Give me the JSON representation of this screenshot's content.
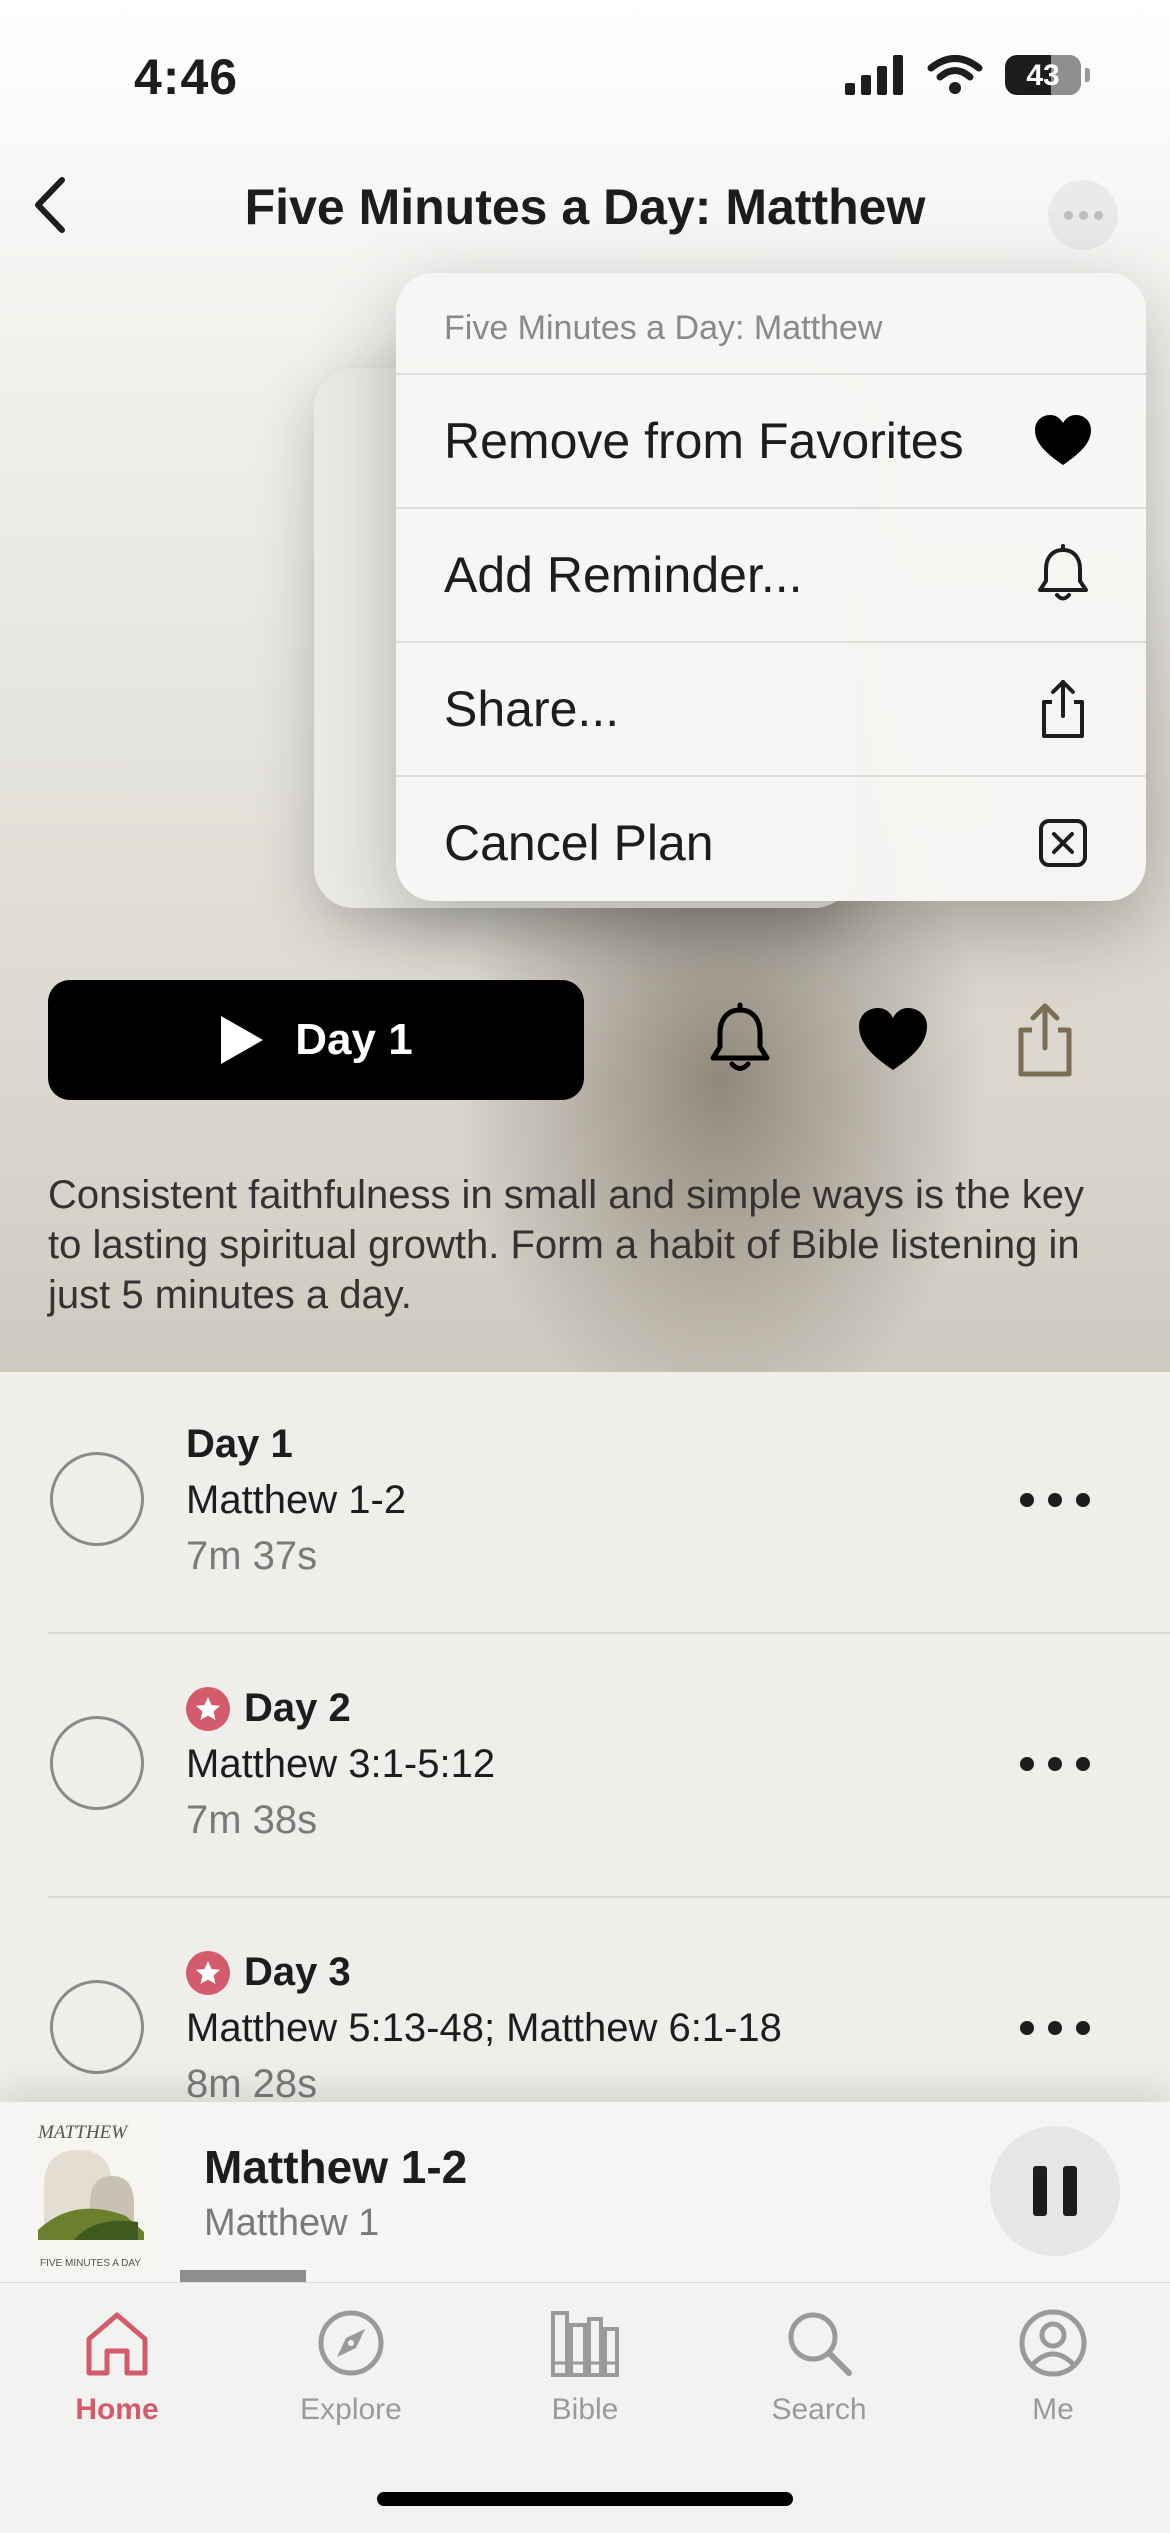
{
  "status_bar": {
    "time": "4:46",
    "battery": "43"
  },
  "nav": {
    "title": "Five Minutes a Day: Matthew"
  },
  "context_menu": {
    "header": "Five Minutes a Day: Matthew",
    "items": [
      {
        "label": "Remove from Favorites",
        "icon": "heart-filled-icon"
      },
      {
        "label": "Add Reminder...",
        "icon": "bell-icon"
      },
      {
        "label": "Share...",
        "icon": "share-icon"
      },
      {
        "label": "Cancel Plan",
        "icon": "x-square-icon"
      }
    ]
  },
  "actions": {
    "play_label": "Day 1"
  },
  "description": "Consistent faithfulness in small and simple ways is the key to lasting spiritual growth. Form a habit of Bible listening in just 5 minutes a day.",
  "plan_days": [
    {
      "day": "Day 1",
      "reference": "Matthew 1-2",
      "duration": "7m 37s",
      "starred": false
    },
    {
      "day": "Day 2",
      "reference": "Matthew 3:1-5:12",
      "duration": "7m 38s",
      "starred": true
    },
    {
      "day": "Day 3",
      "reference": "Matthew 5:13-48; Matthew 6:1-18",
      "duration": "8m 28s",
      "starred": true
    }
  ],
  "mini_player": {
    "title": "Matthew 1-2",
    "subtitle": "Matthew 1",
    "art_title": "MATTHEW",
    "art_caption": "FIVE MINUTES A DAY",
    "progress": 0.1
  },
  "tab_bar": {
    "tabs": [
      {
        "label": "Home",
        "active": true
      },
      {
        "label": "Explore",
        "active": false
      },
      {
        "label": "Bible",
        "active": false
      },
      {
        "label": "Search",
        "active": false
      },
      {
        "label": "Me",
        "active": false
      }
    ]
  },
  "colors": {
    "accent": "#d35b6c",
    "primary_button": "#000000"
  }
}
